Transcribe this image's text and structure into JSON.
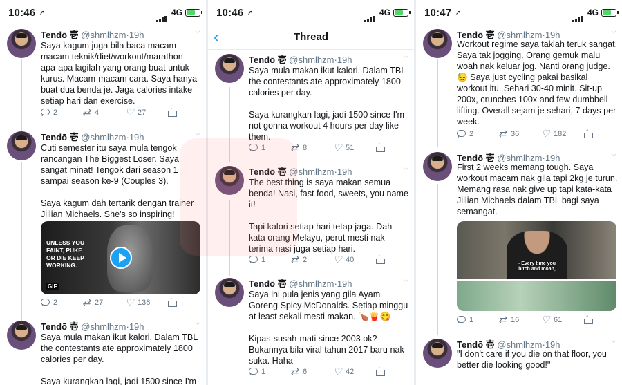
{
  "status": {
    "time1": "10:46",
    "time2": "10:46",
    "time3": "10:47",
    "network": "4G"
  },
  "nav": {
    "title": "Thread"
  },
  "author": {
    "name": "Tendō 壱",
    "handle": "@shmlhzm",
    "sep": "·",
    "age": "19h"
  },
  "panel1": [
    {
      "paragraphs": [
        "Saya kagum juga bila baca macam-macam teknik/diet/workout/marathon apa-apa lagilah yang orang buat untuk kurus. Macam-macam cara. Saya hanya buat dua benda je. Jaga calories intake setiap hari dan exercise."
      ],
      "replies": "2",
      "retweets": "4",
      "likes": "27"
    },
    {
      "paragraphs": [
        "Cuti semester itu saya mula tengok rancangan The Biggest Loser. Saya sangat minat! Tengok dari season 1 sampai season ke-9 (Couples 3).",
        "Saya kagum dah tertarik dengan trainer Jillian Michaels. She's so inspiring!"
      ],
      "gif_caption": "UNLESS YOU FAINT, PUKE OR DIE KEEP WORKING.",
      "gif_badge": "GIF",
      "replies": "2",
      "retweets": "27",
      "likes": "136"
    },
    {
      "paragraphs": [
        "Saya mula makan ikut kalori. Dalam TBL the contestants ate approximately 1800 calories per day.",
        "Saya kurangkan lagi, jadi 1500 since I'm"
      ]
    }
  ],
  "panel2": [
    {
      "paragraphs": [
        "Saya mula makan ikut kalori. Dalam TBL the contestants ate approximately 1800 calories per day.",
        "Saya kurangkan lagi, jadi 1500 since I'm not gonna workout 4 hours per day like them."
      ],
      "replies": "1",
      "retweets": "8",
      "likes": "51"
    },
    {
      "paragraphs": [
        "The best thing is saya makan semua benda! Nasi, fast food, sweets, you name it!",
        "Tapi kalori setiap hari tetap jaga. Dah kata orang Melayu, perut mesti nak terima nasi juga setiap hari."
      ],
      "replies": "1",
      "retweets": "2",
      "likes": "40"
    },
    {
      "paragraphs": [
        "Saya ini pula jenis yang gila Ayam Goreng Spicy McDonalds. Setiap minggu at least sekali mesti makan. 🍗🍟😋",
        "Kipas-susah-mati since 2003 ok? Bukannya bila viral tahun 2017 baru nak suka. Haha"
      ],
      "replies": "1",
      "retweets": "6",
      "likes": "42"
    }
  ],
  "panel3": [
    {
      "paragraphs": [
        "Workout regime saya taklah teruk sangat. Saya tak jogging. Orang gemuk malu woah nak keluar jog. Nanti orang judge. 😓 Saya just cycling pakai basikal workout itu. Sehari 30-40 minit. Sit-up 200x, crunches 100x and few dumbbell lifting. Overall sejam je sehari, 7 days per week."
      ],
      "replies": "2",
      "retweets": "36",
      "likes": "182"
    },
    {
      "paragraphs": [
        "First 2 weeks memang tough. Saya workout macam nak gila tapi 2kg je turun. Memang rasa nak give up tapi kata-kata Jillian Michaels dalam TBL bagi saya semangat."
      ],
      "photo_caption": "- Every time you bitch and moan,",
      "replies": "1",
      "retweets": "16",
      "likes": "61"
    },
    {
      "paragraphs": [
        "\"I don't care if you die on that floor, you better die looking good!\""
      ]
    }
  ]
}
